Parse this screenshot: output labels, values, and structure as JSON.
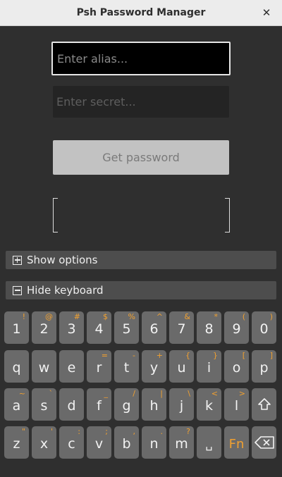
{
  "window": {
    "title": "Psh Password Manager",
    "close_glyph": "✕"
  },
  "form": {
    "alias_placeholder": "Enter alias...",
    "alias_value": "",
    "secret_placeholder": "Enter secret...",
    "secret_value": "",
    "get_password_label": "Get password",
    "result_value": ""
  },
  "options": {
    "show_options_label": "Show options",
    "hide_keyboard_label": "Hide keyboard"
  },
  "colors": {
    "background": "#2f2f2f",
    "key": "#6a6a6a",
    "accent_orange": "#f0a030"
  },
  "keyboard": {
    "rows": [
      [
        {
          "key": "1",
          "alt": "!"
        },
        {
          "key": "2",
          "alt": "@"
        },
        {
          "key": "3",
          "alt": "#"
        },
        {
          "key": "4",
          "alt": "$"
        },
        {
          "key": "5",
          "alt": "%"
        },
        {
          "key": "6",
          "alt": "^"
        },
        {
          "key": "7",
          "alt": "&"
        },
        {
          "key": "8",
          "alt": "*"
        },
        {
          "key": "9",
          "alt": "("
        },
        {
          "key": "0",
          "alt": ")"
        }
      ],
      [
        {
          "key": "q",
          "alt": ""
        },
        {
          "key": "w",
          "alt": ""
        },
        {
          "key": "e",
          "alt": ""
        },
        {
          "key": "r",
          "alt": "="
        },
        {
          "key": "t",
          "alt": "-"
        },
        {
          "key": "y",
          "alt": "+"
        },
        {
          "key": "u",
          "alt": "{"
        },
        {
          "key": "i",
          "alt": "}"
        },
        {
          "key": "o",
          "alt": "["
        },
        {
          "key": "p",
          "alt": "]"
        }
      ],
      [
        {
          "key": "a",
          "alt": "~"
        },
        {
          "key": "s",
          "alt": "`"
        },
        {
          "key": "d",
          "alt": ""
        },
        {
          "key": "f",
          "alt": "_"
        },
        {
          "key": "g",
          "alt": "/"
        },
        {
          "key": "h",
          "alt": "|"
        },
        {
          "key": "j",
          "alt": "\\"
        },
        {
          "key": "k",
          "alt": "<"
        },
        {
          "key": "l",
          "alt": ">"
        },
        {
          "key": "",
          "alt": "",
          "icon": "shift-icon"
        }
      ],
      [
        {
          "key": "z",
          "alt": "\""
        },
        {
          "key": "x",
          "alt": "'"
        },
        {
          "key": "c",
          "alt": ":"
        },
        {
          "key": "v",
          "alt": ";"
        },
        {
          "key": "b",
          "alt": ","
        },
        {
          "key": "n",
          "alt": "."
        },
        {
          "key": "m",
          "alt": "?"
        },
        {
          "key": "␣",
          "alt": ""
        },
        {
          "key": "Fn",
          "alt": ""
        },
        {
          "key": "",
          "alt": "",
          "icon": "backspace-icon"
        }
      ]
    ]
  }
}
